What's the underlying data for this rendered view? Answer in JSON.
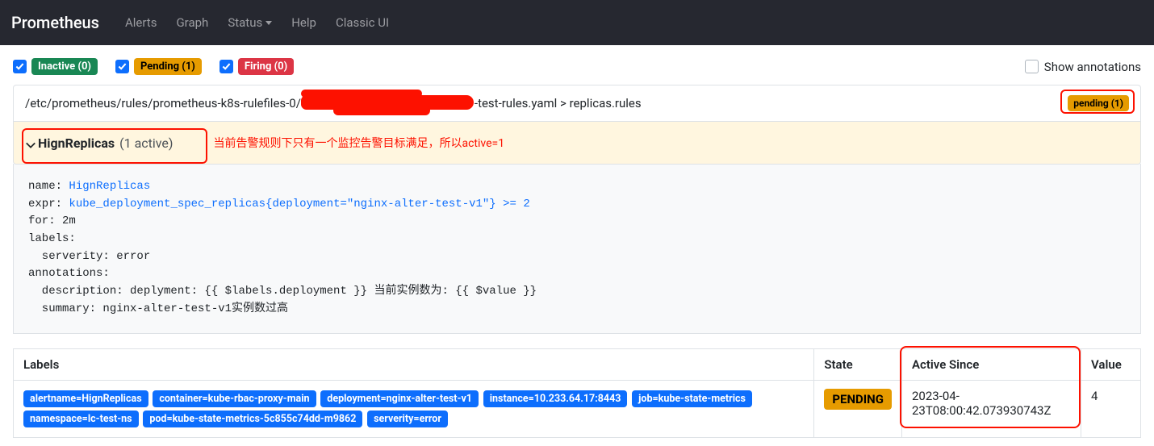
{
  "nav": {
    "brand": "Prometheus",
    "links": [
      "Alerts",
      "Graph",
      "Status",
      "Help",
      "Classic UI"
    ]
  },
  "filters": {
    "inactive_label": "Inactive (0)",
    "pending_label": "Pending (1)",
    "firing_label": "Firing (0)",
    "show_annotations_label": "Show annotations"
  },
  "rule_file": {
    "path_prefix": "/etc/prometheus/rules/prometheus-k8s-rulefiles-0/",
    "path_suffix": "-test-rules.yaml > replicas.rules",
    "pending_badge": "pending (1)"
  },
  "alert_expander": {
    "name": "HignReplicas",
    "count": "(1 active)"
  },
  "annotation_cn": "当前告警规则下只有一个监控告警目标满足，所以active=1",
  "rule_yaml": {
    "name_key": "name:",
    "name_val": "HignReplicas",
    "expr_key": "expr:",
    "expr_val": "kube_deployment_spec_replicas{deployment=\"nginx-alter-test-v1\"} >= 2",
    "for_line": "for: 2m",
    "labels_line": "labels:",
    "severity_line": "  serverity: error",
    "annotations_line": "annotations:",
    "desc_line": "  description: deplyment: {{ $labels.deployment }} 当前实例数为: {{ $value }}",
    "summary_line": "  summary: nginx-alter-test-v1实例数过高"
  },
  "table": {
    "headers": {
      "labels": "Labels",
      "state": "State",
      "since": "Active Since",
      "value": "Value"
    },
    "row": {
      "labels": [
        "alertname=HignReplicas",
        "container=kube-rbac-proxy-main",
        "deployment=nginx-alter-test-v1",
        "instance=10.233.64.17:8443",
        "job=kube-state-metrics",
        "namespace=lc-test-ns",
        "pod=kube-state-metrics-5c855c74dd-m9862",
        "serverity=error"
      ],
      "state": "PENDING",
      "since": "2023-04-23T08:00:42.073930743Z",
      "value": "4"
    }
  }
}
